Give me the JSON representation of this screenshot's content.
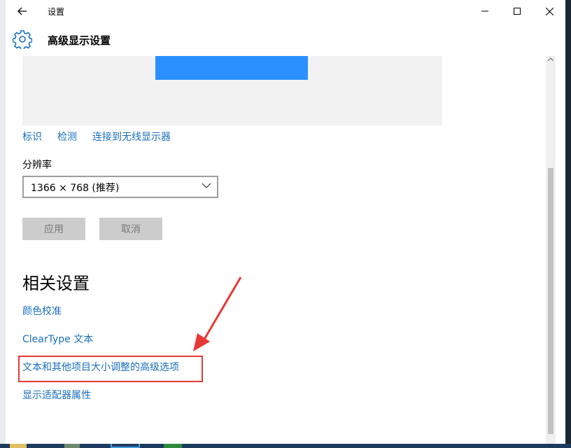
{
  "window": {
    "title": "设置",
    "header_title": "高级显示设置"
  },
  "display": {
    "links": [
      "标识",
      "检测",
      "连接到无线显示器"
    ]
  },
  "resolution": {
    "label": "分辨率",
    "value": "1366 × 768 (推荐)"
  },
  "buttons": {
    "apply": "应用",
    "cancel": "取消"
  },
  "related": {
    "title": "相关设置",
    "links": [
      "颜色校准",
      "ClearType 文本",
      "文本和其他项目大小调整的高级选项",
      "显示适配器属性"
    ]
  },
  "colors": {
    "accent": "#2a8fff",
    "link": "#1a6fbd",
    "highlight": "#e53935"
  }
}
